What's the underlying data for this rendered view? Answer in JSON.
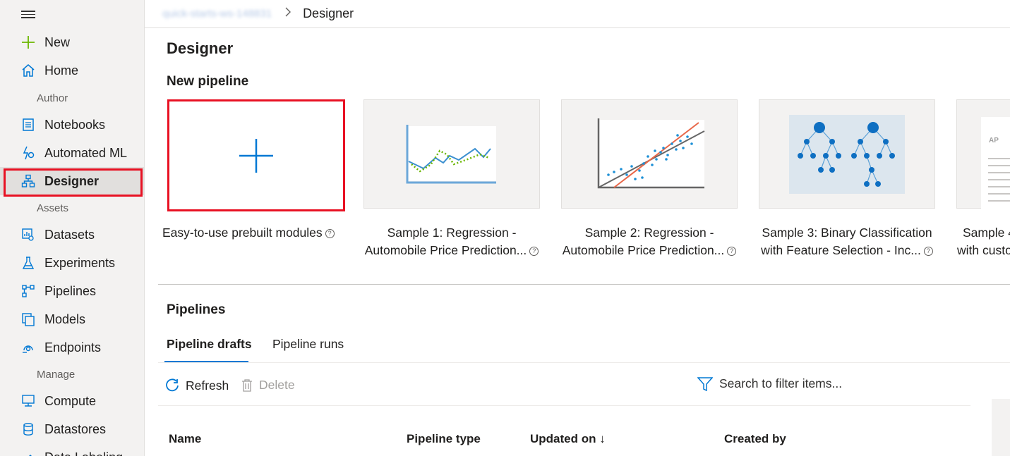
{
  "breadcrumb": {
    "workspace": "quick-starts-ws-148831",
    "current": "Designer"
  },
  "sidebar": {
    "items": [
      {
        "id": "new",
        "label": "New",
        "icon": "plus-icon"
      },
      {
        "id": "home",
        "label": "Home",
        "icon": "home-icon"
      },
      {
        "id": "notebooks",
        "label": "Notebooks",
        "icon": "notebook-icon"
      },
      {
        "id": "automated-ml",
        "label": "Automated ML",
        "icon": "automl-icon"
      },
      {
        "id": "designer",
        "label": "Designer",
        "icon": "designer-icon",
        "selected": true
      },
      {
        "id": "datasets",
        "label": "Datasets",
        "icon": "dataset-icon"
      },
      {
        "id": "experiments",
        "label": "Experiments",
        "icon": "flask-icon"
      },
      {
        "id": "pipelines",
        "label": "Pipelines",
        "icon": "pipeline-icon"
      },
      {
        "id": "models",
        "label": "Models",
        "icon": "models-icon"
      },
      {
        "id": "endpoints",
        "label": "Endpoints",
        "icon": "endpoint-icon"
      },
      {
        "id": "compute",
        "label": "Compute",
        "icon": "compute-icon"
      },
      {
        "id": "datastores",
        "label": "Datastores",
        "icon": "datastore-icon"
      },
      {
        "id": "data-labeling",
        "label": "Data Labeling",
        "icon": "labeling-icon"
      }
    ],
    "sections": {
      "author": "Author",
      "assets": "Assets",
      "manage": "Manage"
    }
  },
  "page": {
    "title": "Designer",
    "new_pipeline": "New pipeline"
  },
  "cards": [
    {
      "caption": "Easy-to-use prebuilt modules",
      "caption2": ""
    },
    {
      "caption": "Sample 1: Regression -",
      "caption2": "Automobile Price Prediction..."
    },
    {
      "caption": "Sample 2: Regression -",
      "caption2": "Automobile Price Prediction..."
    },
    {
      "caption": "Sample 3: Binary Classification",
      "caption2": "with Feature Selection - Inc..."
    },
    {
      "caption": "Sample 4",
      "caption2": "with custo"
    }
  ],
  "help_glyph": "?",
  "card4_thumb_text": "AP",
  "pipelines": {
    "title": "Pipelines",
    "tabs": [
      "Pipeline drafts",
      "Pipeline runs"
    ],
    "refresh": "Refresh",
    "delete": "Delete",
    "search_placeholder": "Search to filter items...",
    "columns": [
      "Name",
      "Pipeline type",
      "Updated on ↓",
      "Created by"
    ]
  },
  "colors": {
    "accent": "#0078d4",
    "highlight": "#e81123",
    "green": "#6bb700"
  }
}
